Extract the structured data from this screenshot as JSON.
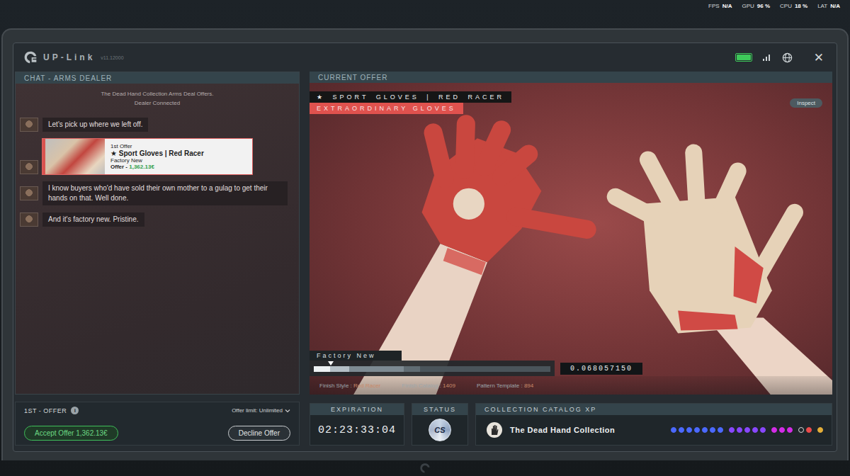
{
  "hud": [
    {
      "label": "FPS",
      "value": "N/A"
    },
    {
      "label": "GPU",
      "value": "96 %"
    },
    {
      "label": "CPU",
      "value": "18 %"
    },
    {
      "label": "LAT",
      "value": "N/A"
    }
  ],
  "app": {
    "title": "UP-Link",
    "version": "v11.12000",
    "battery_level": 1,
    "close": "✕"
  },
  "chat": {
    "title": "CHAT - ARMS DEALER",
    "notices": [
      "The Dead Hand Collection Arms Deal Offers.",
      "Dealer Connected"
    ],
    "messages": [
      {
        "kind": "text",
        "text": "Let's pick up where we left off."
      },
      {
        "kind": "offer",
        "label": "1st Offer",
        "item": "★ Sport Gloves | Red Racer",
        "wear": "Factory New",
        "price_label": "Offer - ",
        "price": "1,362.13€",
        "selected": true
      },
      {
        "kind": "text",
        "text": "I know buyers who'd have sold their own mother to a gulag to get their hands on that. Well done."
      },
      {
        "kind": "text",
        "text": "And it's factory new. Pristine."
      }
    ]
  },
  "offer_bar": {
    "title": "1ST - OFFER",
    "info": "i",
    "limit": "Offer limit: Unlimited",
    "accept": "Accept Offer 1,362.13€",
    "decline": "Decline Offer"
  },
  "current_offer": {
    "title": "CURRENT OFFER",
    "name": "★ SPORT GLOVES | RED RACER",
    "rarity": "EXTRAORDINARY GLOVES",
    "inspect": "Inspect",
    "wear_label": "Factory New",
    "wear_level": 0.068,
    "wear_segments": [
      0.07,
      0.15,
      0.38,
      0.45,
      1
    ],
    "float": "0.068057150",
    "details": [
      {
        "label": "Finish Style : ",
        "value": "Red Racer"
      },
      {
        "label": "Finish Catalog : ",
        "value": "1409"
      },
      {
        "label": "Pattern Template : ",
        "value": "894"
      }
    ]
  },
  "expiration": {
    "label": "EXPIRATION",
    "time": "02:23:33:04"
  },
  "status": {
    "label": "STATUS",
    "badge": "CS"
  },
  "collection": {
    "label": "COLLECTION CATALOG XP",
    "name": "The Dead Hand Collection",
    "dots": [
      {
        "color": "#4b69ff",
        "filled": true
      },
      {
        "color": "#4b69ff",
        "filled": true
      },
      {
        "color": "#4b69ff",
        "filled": true
      },
      {
        "color": "#4b69ff",
        "filled": true
      },
      {
        "color": "#4b69ff",
        "filled": true
      },
      {
        "color": "#4b69ff",
        "filled": true
      },
      {
        "color": "#4b69ff",
        "filled": true
      },
      {
        "color": "#8847ff",
        "filled": true
      },
      {
        "color": "#8847ff",
        "filled": true
      },
      {
        "color": "#8847ff",
        "filled": true
      },
      {
        "color": "#8847ff",
        "filled": true
      },
      {
        "color": "#8847ff",
        "filled": true
      },
      {
        "color": "#d32ce6",
        "filled": true
      },
      {
        "color": "#d32ce6",
        "filled": true
      },
      {
        "color": "#d32ce6",
        "filled": true
      },
      {
        "color": "#eb4b4b",
        "filled": false
      },
      {
        "color": "#eb4b4b",
        "filled": true
      },
      {
        "color": "#e4ae39",
        "filled": true
      }
    ]
  }
}
